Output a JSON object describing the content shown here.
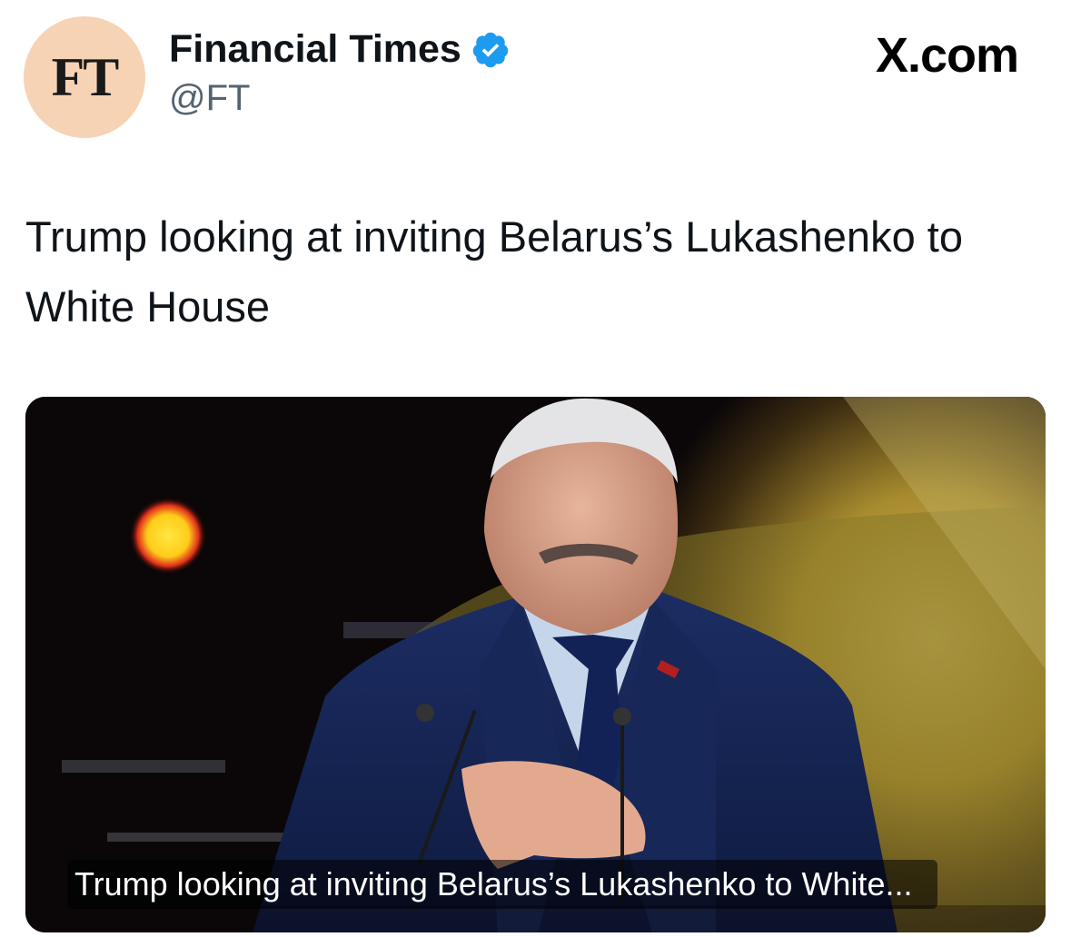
{
  "author": {
    "avatar_text": "FT",
    "display_name": "Financial Times",
    "handle": "@FT",
    "verified": true,
    "verified_color": "#1d9bf0"
  },
  "source_site": "X.com",
  "post": {
    "text": "Trump looking at inviting Belarus’s Lukashenko to White House"
  },
  "link_card": {
    "caption": "Trump looking at inviting Belarus’s Lukashenko to White..."
  },
  "colors": {
    "avatar_bg": "#f6d3b4",
    "text_primary": "#0f1419",
    "text_secondary": "#536471"
  }
}
